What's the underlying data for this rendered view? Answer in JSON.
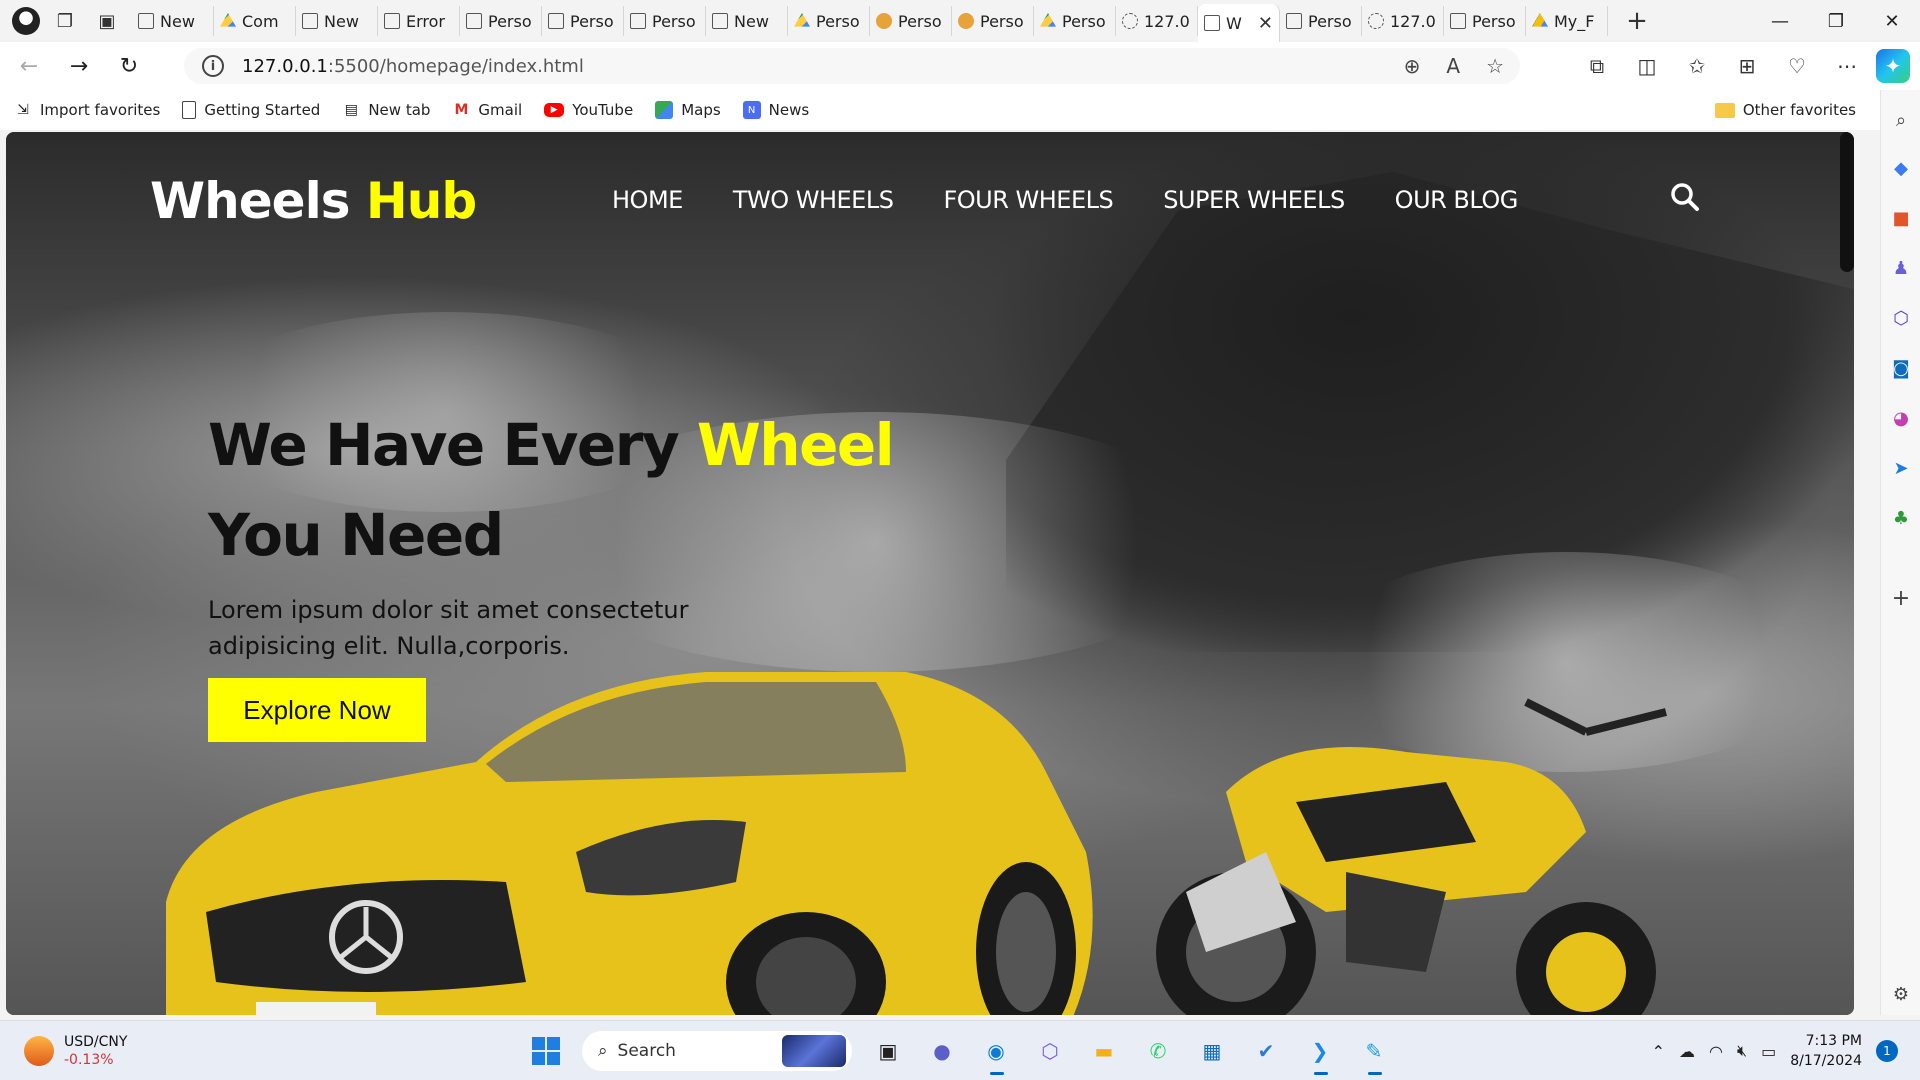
{
  "browser": {
    "tabs": [
      {
        "label": "New",
        "icon": "page-icon"
      },
      {
        "label": "Com",
        "icon": "drive-icon"
      },
      {
        "label": "New",
        "icon": "page-icon"
      },
      {
        "label": "Error",
        "icon": "document-icon"
      },
      {
        "label": "Perso",
        "icon": "document-icon"
      },
      {
        "label": "Perso",
        "icon": "document-icon"
      },
      {
        "label": "Perso",
        "icon": "document-icon"
      },
      {
        "label": "New",
        "icon": "page-icon"
      },
      {
        "label": "Perso",
        "icon": "drive-icon"
      },
      {
        "label": "Perso",
        "icon": "face-icon"
      },
      {
        "label": "Perso",
        "icon": "face-icon"
      },
      {
        "label": "Perso",
        "icon": "drive-icon"
      },
      {
        "label": "127.0",
        "icon": "gear-icon"
      },
      {
        "label": "W",
        "icon": "document-icon",
        "active": true
      },
      {
        "label": "Perso",
        "icon": "document-icon"
      },
      {
        "label": "127.0",
        "icon": "gear-icon"
      },
      {
        "label": "Perso",
        "icon": "document-icon"
      },
      {
        "label": "My_F",
        "icon": "google-drive-icon"
      }
    ],
    "url_host": "127.0.0.1",
    "url_path": ":5500/homepage/index.html",
    "favorites": [
      {
        "label": "Import favorites",
        "icon": "import-icon"
      },
      {
        "label": "Getting Started",
        "icon": "document-icon"
      },
      {
        "label": "New tab",
        "icon": "newtab-icon"
      },
      {
        "label": "Gmail",
        "icon": "gmail-icon"
      },
      {
        "label": "YouTube",
        "icon": "youtube-icon"
      },
      {
        "label": "Maps",
        "icon": "maps-icon"
      },
      {
        "label": "News",
        "icon": "news-icon"
      }
    ],
    "other_favorites": "Other favorites"
  },
  "site": {
    "logo_main": "Wheels ",
    "logo_accent": "Hub",
    "menu": [
      "HOME",
      "TWO WHEELS",
      "FOUR WHEELS",
      "SUPER WHEELS",
      "OUR BLOG"
    ],
    "hero_line1": "We Have Every ",
    "hero_accent": "Wheel",
    "hero_line2": "You Need",
    "hero_desc": "Lorem ipsum dolor sit amet consectetur adipisicing elit. Nulla,corporis.",
    "cta": "Explore Now",
    "colors": {
      "accent": "#ffff00",
      "text_dark": "#111111",
      "nav_text": "#ffffff"
    }
  },
  "taskbar": {
    "widget_title": "USD/CNY",
    "widget_value": "-0.13%",
    "search_placeholder": "Search",
    "time": "7:13 PM",
    "date": "8/17/2024",
    "notifications": "1"
  }
}
